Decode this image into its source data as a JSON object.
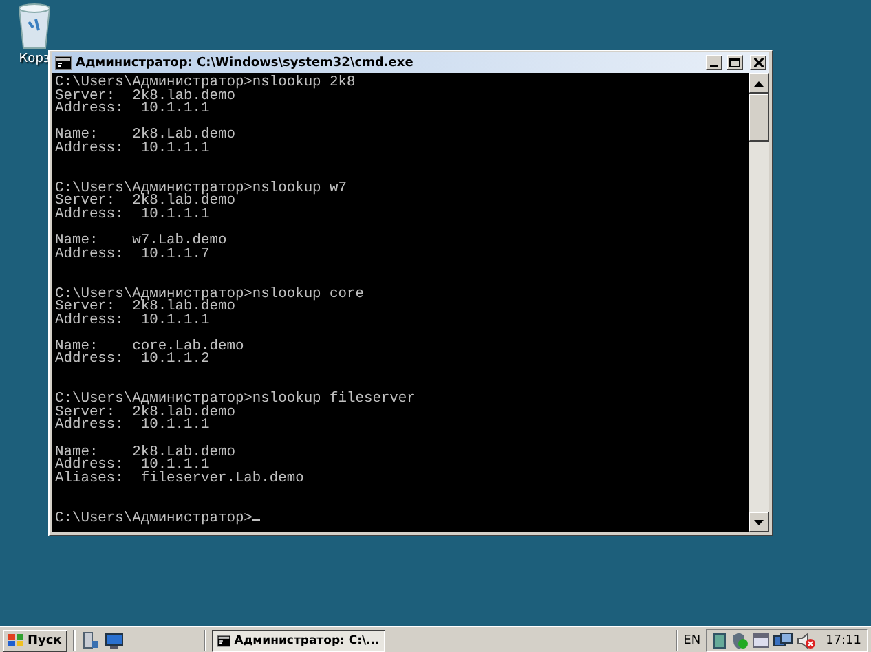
{
  "desktop_icons": [
    {
      "label": "Корз"
    }
  ],
  "window": {
    "title": "Администратор: C:\\Windows\\system32\\cmd.exe",
    "sections": [
      {
        "paragraphs": [
          [
            "C:\\Users\\Администратор>nslookup 2k8",
            "Server:  2k8.lab.demo",
            "Address:  10.1.1.1"
          ],
          [
            "Name:    2k8.Lab.demo",
            "Address:  10.1.1.1"
          ]
        ]
      },
      {
        "paragraphs": [
          [
            "C:\\Users\\Администратор>nslookup w7",
            "Server:  2k8.lab.demo",
            "Address:  10.1.1.1"
          ],
          [
            "Name:    w7.Lab.demo",
            "Address:  10.1.1.7"
          ]
        ]
      },
      {
        "paragraphs": [
          [
            "C:\\Users\\Администратор>nslookup core",
            "Server:  2k8.lab.demo",
            "Address:  10.1.1.1"
          ],
          [
            "Name:    core.Lab.demo",
            "Address:  10.1.1.2"
          ]
        ]
      },
      {
        "paragraphs": [
          [
            "C:\\Users\\Администратор>nslookup fileserver",
            "Server:  2k8.lab.demo",
            "Address:  10.1.1.1"
          ],
          [
            "Name:    2k8.Lab.demo",
            "Address:  10.1.1.1",
            "Aliases:  fileserver.Lab.demo"
          ]
        ]
      }
    ],
    "prompt": "C:\\Users\\Администратор>"
  },
  "taskbar": {
    "start": "Пуск",
    "tasks": [
      {
        "label": "Администратор: C:\\...",
        "selected": true
      }
    ],
    "language": "EN",
    "clock": "17:11"
  }
}
